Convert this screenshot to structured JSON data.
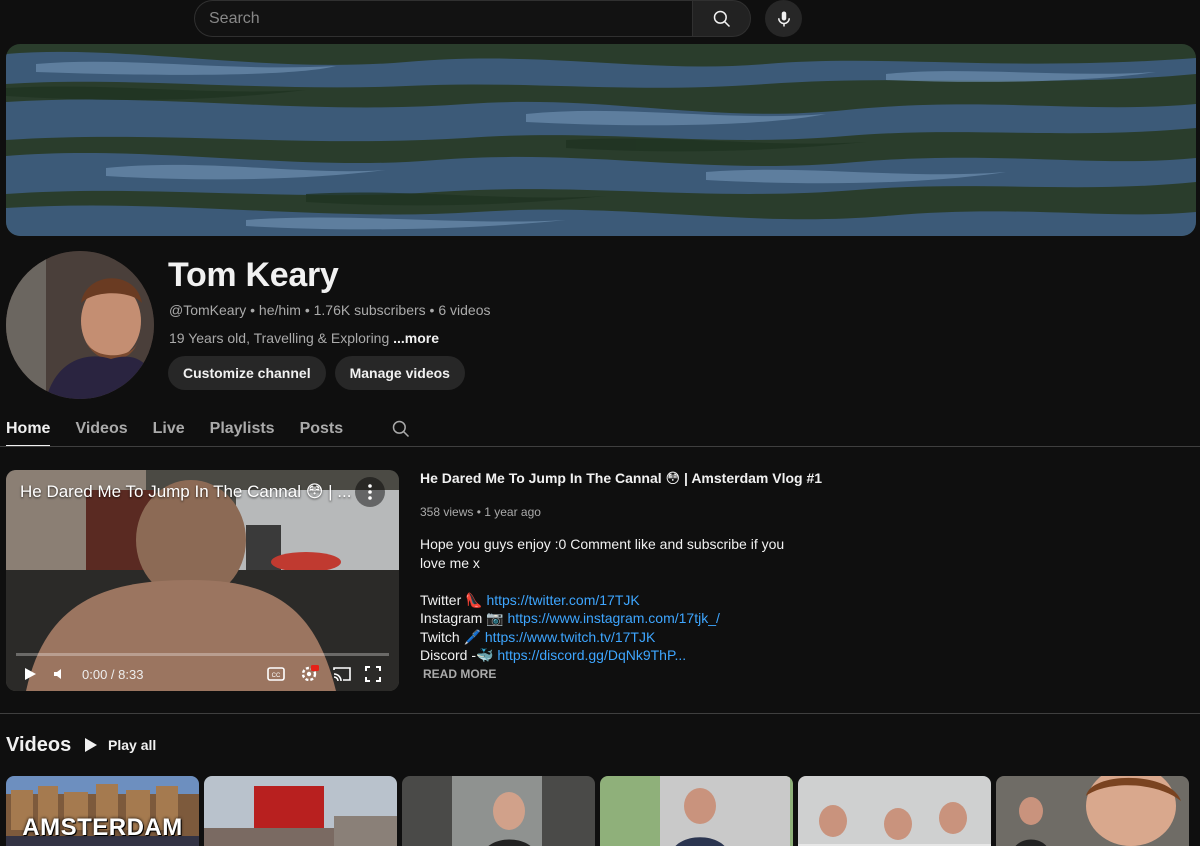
{
  "search": {
    "placeholder": "Search"
  },
  "channel": {
    "name": "Tom Keary",
    "meta": "@TomKeary • he/him • 1.76K subscribers • 6 videos",
    "description": "19 Years old, Travelling & Exploring ",
    "more": "...more",
    "buttons": {
      "customize": "Customize channel",
      "manage": "Manage videos"
    }
  },
  "tabs": [
    "Home",
    "Videos",
    "Live",
    "Playlists",
    "Posts"
  ],
  "featured": {
    "overlay_title": "He Dared Me To Jump In The Cannal 😳 | ...",
    "time": "0:00 / 8:33",
    "progress": 0,
    "title": "He Dared Me To Jump In The Cannal 😳  | Amsterdam Vlog #1",
    "stats": "358 views • 1 year ago",
    "desc_line1": "Hope you guys enjoy :0 Comment like and subscribe if you love me x",
    "links": [
      {
        "label": "Twitter 👠 ",
        "url": "https://twitter.com/17TJK"
      },
      {
        "label": "Instagram 📷 ",
        "url": "https://www.instagram.com/17tjk_/"
      },
      {
        "label": "Twitch 🖊️ ",
        "url": "https://www.twitch.tv/17TJK"
      },
      {
        "label": "Discord -🐳  ",
        "url": "https://discord.gg/DqNk9ThP..."
      }
    ],
    "read_more": "READ MORE"
  },
  "videos_section": {
    "title": "Videos",
    "play_all": "Play all"
  },
  "thumbs": [
    {
      "text": "AMSTERDAM"
    },
    {
      "text": ""
    },
    {
      "text": ""
    },
    {
      "text": ""
    },
    {
      "text": ""
    },
    {
      "text": ""
    }
  ],
  "colors": {
    "bg": "#0f0f0f",
    "link": "#3ea6ff",
    "chip": "#272727",
    "muted": "#aaaaaa"
  }
}
